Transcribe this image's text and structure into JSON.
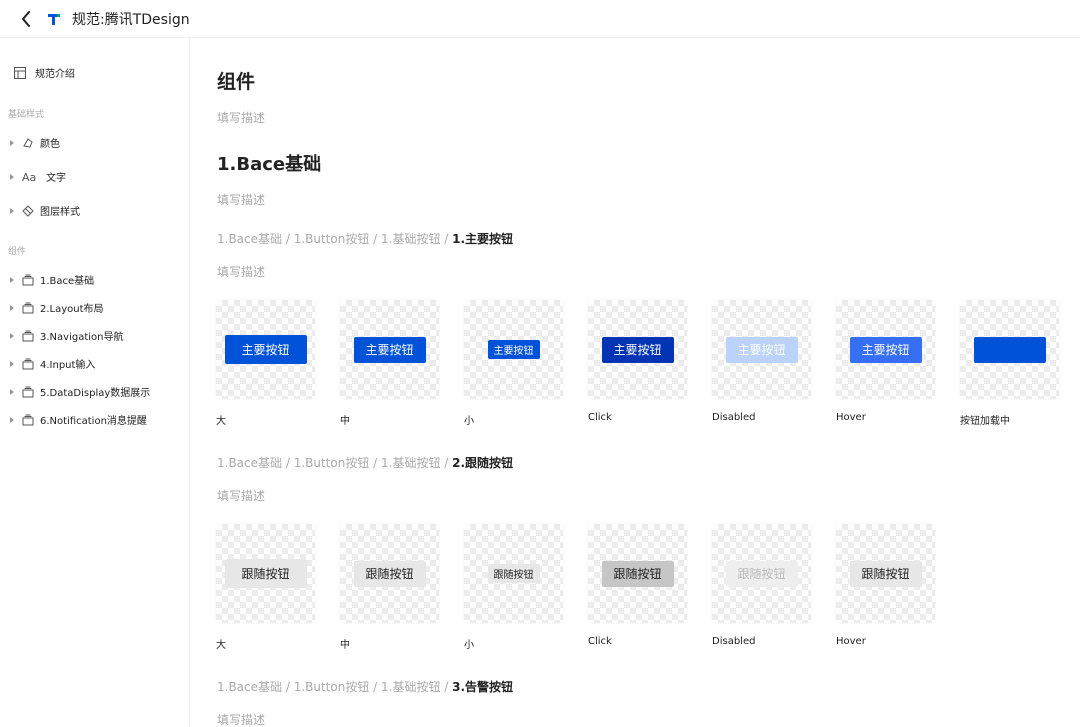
{
  "topbar": {
    "title": "规范:腾讯TDesign"
  },
  "sidebar": {
    "intro": "规范介绍",
    "group_basic": "基础样式",
    "basic_items": [
      {
        "label": "颜色",
        "icon": "color-icon"
      },
      {
        "label": "文字",
        "icon": "text-icon"
      },
      {
        "label": "图层样式",
        "icon": "layer-style-icon"
      }
    ],
    "group_components": "组件",
    "component_items": [
      {
        "label": "1.Bace基础"
      },
      {
        "label": "2.Layout布局"
      },
      {
        "label": "3.Navigation导航"
      },
      {
        "label": "4.Input输入"
      },
      {
        "label": "5.DataDisplay数据展示"
      },
      {
        "label": "6.Notification消息提醒"
      }
    ]
  },
  "main": {
    "title": "组件",
    "desc": "填写描述",
    "section_title": "1.Bace基础",
    "section_desc": "填写描述",
    "groups": [
      {
        "crumb_prefix": "1.Bace基础 / 1.Button按钮 / 1.基础按钮 / ",
        "crumb_current": "1.主要按钮",
        "desc": "填写描述",
        "items": [
          {
            "button": "主要按钮",
            "caption": "大"
          },
          {
            "button": "主要按钮",
            "caption": "中"
          },
          {
            "button": "主要按钮",
            "caption": "小"
          },
          {
            "button": "主要按钮",
            "caption": "Click"
          },
          {
            "button": "主要按钮",
            "caption": "Disabled"
          },
          {
            "button": "主要按钮",
            "caption": "Hover"
          },
          {
            "button": "",
            "caption": "按钮加载中"
          }
        ]
      },
      {
        "crumb_prefix": "1.Bace基础 / 1.Button按钮 / 1.基础按钮 / ",
        "crumb_current": "2.跟随按钮",
        "desc": "填写描述",
        "items": [
          {
            "button": "跟随按钮",
            "caption": "大"
          },
          {
            "button": "跟随按钮",
            "caption": "中"
          },
          {
            "button": "跟随按钮",
            "caption": "小"
          },
          {
            "button": "跟随按钮",
            "caption": "Click"
          },
          {
            "button": "跟随按钮",
            "caption": "Disabled"
          },
          {
            "button": "跟随按钮",
            "caption": "Hover"
          }
        ]
      },
      {
        "crumb_prefix": "1.Bace基础 / 1.Button按钮 / 1.基础按钮 / ",
        "crumb_current": "3.告警按钮",
        "desc": "填写描述"
      }
    ]
  },
  "colors": {
    "primary": "#0052d9",
    "primary_click": "#0034b5",
    "primary_disabled": "#bbd3fb",
    "primary_hover": "#366ef4",
    "follow": "#e7e7e7",
    "follow_click": "#c6c6c6"
  }
}
